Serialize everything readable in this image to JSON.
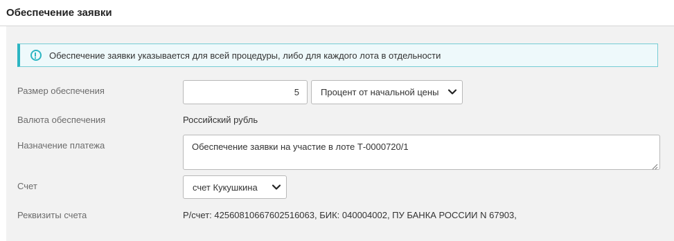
{
  "header": {
    "title": "Обеспечение заявки"
  },
  "alert": {
    "icon": "info-circle-icon",
    "text": "Обеспечение заявки указывается для всей процедуры, либо для каждого лота в отдельности",
    "accent_color": "#2cb5c2"
  },
  "form": {
    "amount": {
      "label": "Размер обеспечения",
      "value": "5",
      "type_selected": "Процент от начальной цены"
    },
    "currency": {
      "label": "Валюта обеспечения",
      "value": "Российский рубль"
    },
    "purpose": {
      "label": "Назначение платежа",
      "value": "Обеспечение заявки на участие в лоте Т-0000720/1"
    },
    "account": {
      "label": "Счет",
      "selected": "счет Кукушкина"
    },
    "details": {
      "label": "Реквизиты счета",
      "value": "Р/счет: 42560810667602516063, БИК: 040004002, ПУ БАНКА РОССИИ N 67903,"
    }
  }
}
